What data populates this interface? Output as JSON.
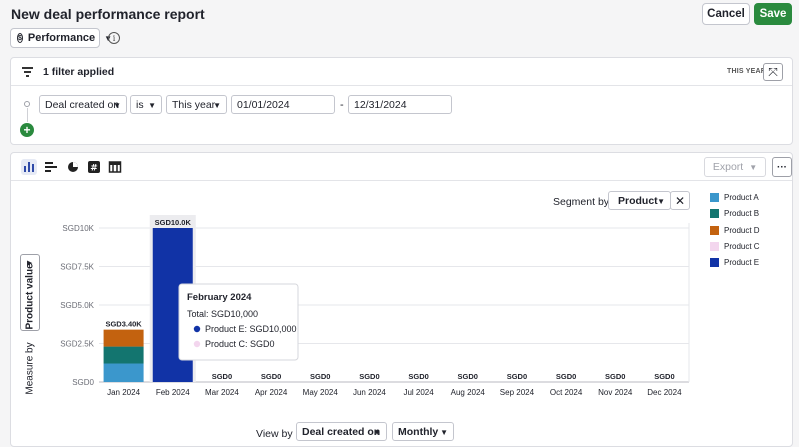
{
  "header": {
    "title": "New deal performance report",
    "cancel_label": "Cancel",
    "save_label": "Save",
    "report_type": "Performance",
    "info_icon": "info-icon"
  },
  "filter": {
    "summary": "1 filter applied",
    "tag": "THIS YEAR",
    "field": "Deal created on",
    "operator": "is",
    "period": "This year",
    "date_from": "01/01/2024",
    "date_to": "12/31/2024",
    "separator": "-"
  },
  "chart_toolbar": {
    "export_label": "Export",
    "more_label": "···",
    "icons": [
      "bar-chart-icon",
      "horizontal-bar-icon",
      "pie-chart-icon",
      "number-icon",
      "table-icon"
    ]
  },
  "controls": {
    "segment_by_label": "Segment by",
    "segment_value": "Product",
    "measure_by_label": "Measure by",
    "measure_value": "Product value",
    "view_by_label": "View by",
    "view_by_field": "Deal created on",
    "view_by_interval": "Monthly"
  },
  "tooltip": {
    "title": "February 2024",
    "total": "Total: SGD10,000",
    "items": [
      {
        "label": "Product E: SGD10,000",
        "color": "#1133a6"
      },
      {
        "label": "Product C: SGD0",
        "color": "#f3d6ee"
      }
    ]
  },
  "chart_data": {
    "type": "bar",
    "stacked": true,
    "categories": [
      "Jan 2024",
      "Feb 2024",
      "Mar 2024",
      "Apr 2024",
      "May 2024",
      "Jun 2024",
      "Jul 2024",
      "Aug 2024",
      "Sep 2024",
      "Oct 2024",
      "Nov 2024",
      "Dec 2024"
    ],
    "totals_labels": [
      "SGD3.40K",
      "SGD10.0K",
      "SGD0",
      "SGD0",
      "SGD0",
      "SGD0",
      "SGD0",
      "SGD0",
      "SGD0",
      "SGD0",
      "SGD0",
      "SGD0"
    ],
    "series": [
      {
        "name": "Product A",
        "color": "#3b97cc",
        "values": [
          1200,
          0,
          0,
          0,
          0,
          0,
          0,
          0,
          0,
          0,
          0,
          0
        ]
      },
      {
        "name": "Product B",
        "color": "#13756f",
        "values": [
          1100,
          0,
          0,
          0,
          0,
          0,
          0,
          0,
          0,
          0,
          0,
          0
        ]
      },
      {
        "name": "Product D",
        "color": "#c3620f",
        "values": [
          1100,
          0,
          0,
          0,
          0,
          0,
          0,
          0,
          0,
          0,
          0,
          0
        ]
      },
      {
        "name": "Product C",
        "color": "#f3d6ee",
        "values": [
          0,
          0,
          0,
          0,
          0,
          0,
          0,
          0,
          0,
          0,
          0,
          0
        ]
      },
      {
        "name": "Product E",
        "color": "#1133a6",
        "values": [
          0,
          10000,
          0,
          0,
          0,
          0,
          0,
          0,
          0,
          0,
          0,
          0
        ]
      }
    ],
    "yticks": [
      0,
      2500,
      5000,
      7500,
      10000
    ],
    "ytick_labels": [
      "SGD0",
      "SGD2.5K",
      "SGD5.0K",
      "SGD7.5K",
      "SGD10K"
    ],
    "ylim": [
      0,
      10000
    ],
    "grid": true,
    "legend": "right",
    "highlighted_category": "Feb 2024"
  }
}
